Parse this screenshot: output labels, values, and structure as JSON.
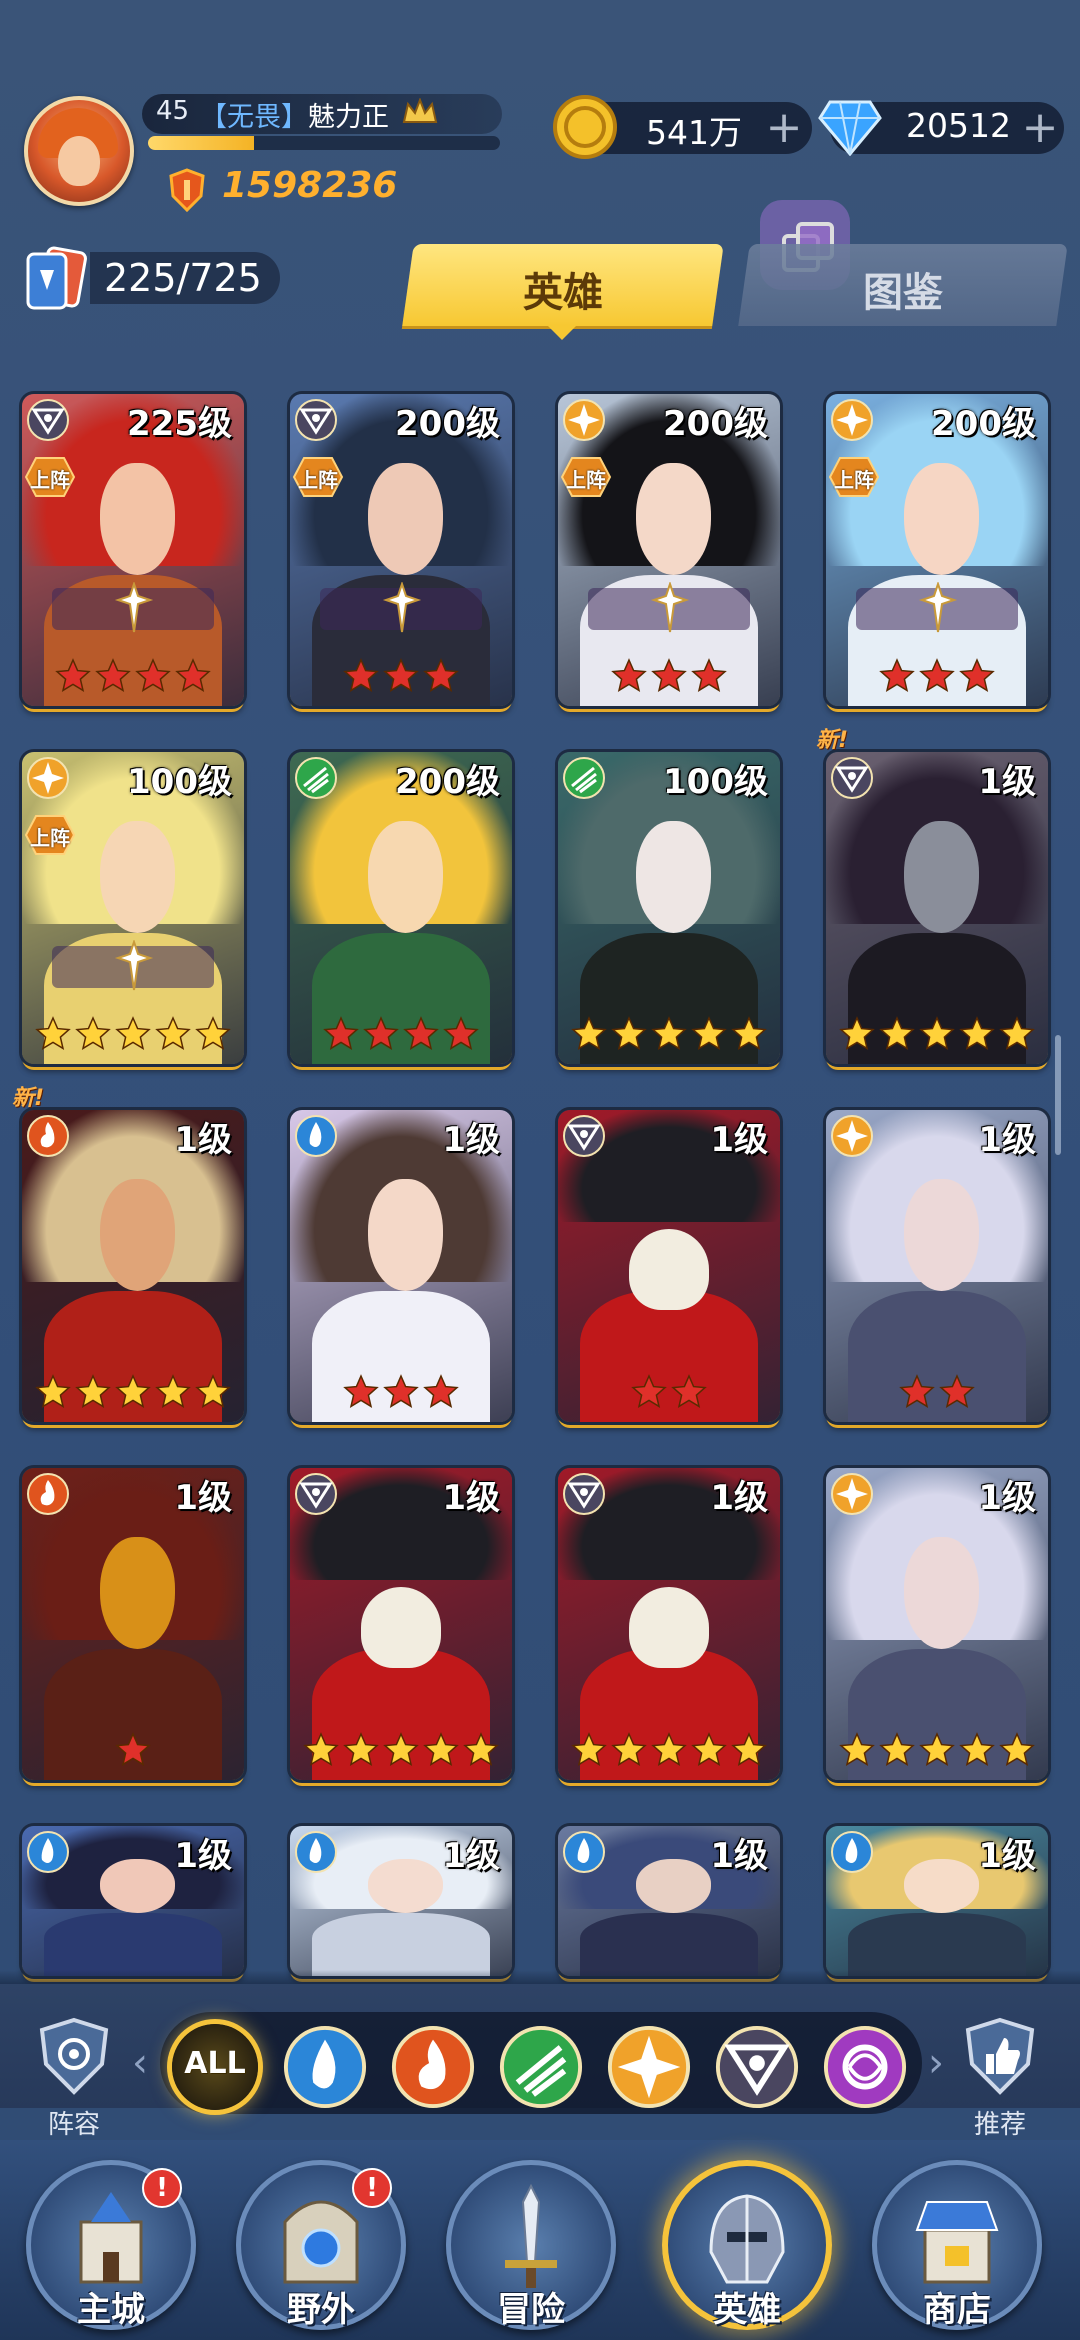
{
  "player": {
    "level": "45",
    "guild_tag": "【无畏】",
    "name": "魅力正",
    "xp_fraction": 0.3,
    "power": "1598236"
  },
  "resources": {
    "gold": "541万",
    "gems": "20512"
  },
  "roster": {
    "count": "225/725"
  },
  "tabs": {
    "heroes": "英雄",
    "codex": "图鉴",
    "active": "heroes"
  },
  "labels": {
    "deploy": "上阵",
    "new": "新!"
  },
  "heroes": [
    {
      "level": "225级",
      "faction": "shadow",
      "stars": 4,
      "star_color": "red",
      "deployed": true,
      "equip": true,
      "new": false
    },
    {
      "level": "200级",
      "faction": "shadow",
      "stars": 3,
      "star_color": "red",
      "deployed": true,
      "equip": true,
      "new": false
    },
    {
      "level": "200级",
      "faction": "light",
      "stars": 3,
      "star_color": "red",
      "deployed": true,
      "equip": true,
      "new": false
    },
    {
      "level": "200级",
      "faction": "light",
      "stars": 3,
      "star_color": "red",
      "deployed": true,
      "equip": true,
      "new": false
    },
    {
      "level": "100级",
      "faction": "light",
      "stars": 5,
      "star_color": "gold",
      "deployed": true,
      "equip": true,
      "new": false
    },
    {
      "level": "200级",
      "faction": "nature",
      "stars": 4,
      "star_color": "red",
      "deployed": false,
      "equip": false,
      "new": false
    },
    {
      "level": "100级",
      "faction": "nature",
      "stars": 5,
      "star_color": "gold",
      "deployed": false,
      "equip": false,
      "new": false
    },
    {
      "level": "1级",
      "faction": "shadow",
      "stars": 5,
      "star_color": "gold",
      "deployed": false,
      "equip": false,
      "new": true
    },
    {
      "level": "1级",
      "faction": "fire",
      "stars": 5,
      "star_color": "gold",
      "deployed": false,
      "equip": false,
      "new": true
    },
    {
      "level": "1级",
      "faction": "water",
      "stars": 3,
      "star_color": "red",
      "deployed": false,
      "equip": false,
      "new": false
    },
    {
      "level": "1级",
      "faction": "shadow",
      "stars": 2,
      "star_color": "red",
      "deployed": false,
      "equip": false,
      "new": false
    },
    {
      "level": "1级",
      "faction": "light",
      "stars": 2,
      "star_color": "red",
      "deployed": false,
      "equip": false,
      "new": false
    },
    {
      "level": "1级",
      "faction": "fire",
      "stars": 1,
      "star_color": "red",
      "deployed": false,
      "equip": false,
      "new": false
    },
    {
      "level": "1级",
      "faction": "shadow",
      "stars": 5,
      "star_color": "gold",
      "deployed": false,
      "equip": false,
      "new": false
    },
    {
      "level": "1级",
      "faction": "shadow",
      "stars": 5,
      "star_color": "gold",
      "deployed": false,
      "equip": false,
      "new": false
    },
    {
      "level": "1级",
      "faction": "light",
      "stars": 5,
      "star_color": "gold",
      "deployed": false,
      "equip": false,
      "new": false
    },
    {
      "level": "1级",
      "faction": "water",
      "stars": 0,
      "star_color": "gold",
      "deployed": false,
      "equip": false,
      "new": false
    },
    {
      "level": "1级",
      "faction": "water",
      "stars": 0,
      "star_color": "gold",
      "deployed": false,
      "equip": false,
      "new": false
    },
    {
      "level": "1级",
      "faction": "water",
      "stars": 0,
      "star_color": "gold",
      "deployed": false,
      "equip": false,
      "new": false
    },
    {
      "level": "1级",
      "faction": "water",
      "stars": 0,
      "star_color": "gold",
      "deployed": false,
      "equip": false,
      "new": false
    }
  ],
  "hero_art": [
    {
      "hair": "#c8261e",
      "skin": "#f3c3a6",
      "body": "#b85a2a",
      "bg": "#d05a5a",
      "type": "face"
    },
    {
      "hair": "#223048",
      "skin": "#eec9b6",
      "body": "#2a2c3a",
      "bg": "#5a7ab0",
      "type": "face"
    },
    {
      "hair": "#141418",
      "skin": "#f4d8c8",
      "body": "#e8e8f0",
      "bg": "#b8c6d8",
      "type": "face"
    },
    {
      "hair": "#9ad4f4",
      "skin": "#f6d6c4",
      "body": "#e6eef6",
      "bg": "#7ab0e0",
      "type": "face"
    },
    {
      "hair": "#f0e28a",
      "skin": "#f6d6b4",
      "body": "#e8d070",
      "bg": "#c8c070",
      "type": "face"
    },
    {
      "hair": "#f2c43c",
      "skin": "#f7d8b0",
      "body": "#2e6a3e",
      "bg": "#3e6a52",
      "type": "face"
    },
    {
      "hair": "#4e6a6a",
      "skin": "#eee6e4",
      "body": "#1e2422",
      "bg": "#3a6a6a",
      "type": "face"
    },
    {
      "hair": "#2a2032",
      "skin": "#8a8e9a",
      "body": "#1c1a22",
      "bg": "#6a6070",
      "type": "face"
    },
    {
      "hair": "#d8c090",
      "skin": "#e0a478",
      "body": "#b02018",
      "bg": "#4a1a1a",
      "type": "face"
    },
    {
      "hair": "#4e3a34",
      "skin": "#f4d8c8",
      "body": "#f0f0f8",
      "bg": "#d8c8e8",
      "type": "face"
    },
    {
      "hair": "#1e1e24",
      "skin": "#f2ede0",
      "body": "#c0181a",
      "bg": "#a01a28",
      "type": "skull"
    },
    {
      "hair": "#d8d8ec",
      "skin": "#ecd8d8",
      "body": "#4a5070",
      "bg": "#9aa8c8",
      "type": "face"
    },
    {
      "hair": "#6a1e16",
      "skin": "#d89018",
      "body": "#5a2016",
      "bg": "#702018",
      "type": "face"
    },
    {
      "hair": "#1e1e24",
      "skin": "#f2ede0",
      "body": "#c0181a",
      "bg": "#a01a28",
      "type": "skull"
    },
    {
      "hair": "#1e1e24",
      "skin": "#f2ede0",
      "body": "#c0181a",
      "bg": "#a01a28",
      "type": "skull"
    },
    {
      "hair": "#d8d8ec",
      "skin": "#ecd8d8",
      "body": "#4a5070",
      "bg": "#9aa8c8",
      "type": "face"
    },
    {
      "hair": "#1e2240",
      "skin": "#f0c8b8",
      "body": "#2a3a70",
      "bg": "#4a6ab0",
      "type": "face"
    },
    {
      "hair": "#e8eef6",
      "skin": "#f4dcd0",
      "body": "#c8d0e0",
      "bg": "#c8d8ee",
      "type": "face"
    },
    {
      "hair": "#3a4a7a",
      "skin": "#e8d0c4",
      "body": "#2a3050",
      "bg": "#6a7aa0",
      "type": "face"
    },
    {
      "hair": "#e8c870",
      "skin": "#f6dcc8",
      "body": "#2a3a50",
      "bg": "#4a8aa0",
      "type": "face"
    }
  ],
  "filters": {
    "lineup_label": "阵容",
    "all_label": "ALL",
    "recommend_label": "推荐",
    "factions": [
      "water-faction-icon",
      "fire-faction-icon",
      "nature-faction-icon",
      "light-faction-icon",
      "shadow-faction-icon",
      "arcane-faction-icon"
    ],
    "selected": "ALL"
  },
  "nav": [
    {
      "label": "主城",
      "alert": true
    },
    {
      "label": "野外",
      "alert": true
    },
    {
      "label": "冒险",
      "alert": false
    },
    {
      "label": "英雄",
      "alert": false,
      "active": true
    },
    {
      "label": "商店",
      "alert": false
    }
  ],
  "colors": {
    "accent_gold": "#f5c33b",
    "power_orange": "#ffb02e",
    "star_red": "#e0302a",
    "star_gold": "#ffd23a",
    "faction_water": "#2b86d8",
    "faction_fire": "#e0541e",
    "faction_nature": "#2ea64a",
    "faction_light": "#f0a22a",
    "faction_shadow": "#4a4660",
    "faction_arcane": "#a03ac0"
  }
}
